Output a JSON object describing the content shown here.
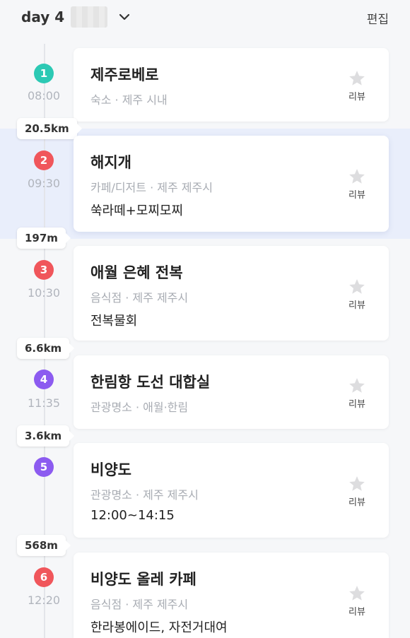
{
  "header": {
    "day_label": "day 4",
    "edit_label": "편집"
  },
  "colors": {
    "teal": "#2cc9b4",
    "red": "#f0565b",
    "purple": "#8c5bf0",
    "highlight": "#e9eefb"
  },
  "review_label": "리뷰",
  "stops": [
    {
      "num": "1",
      "time": "08:00",
      "title": "제주로베로",
      "sub": "숙소 · 제주 시내",
      "note": ""
    },
    {
      "num": "2",
      "time": "09:30",
      "title": "해지개",
      "sub": "카페/디저트 · 제주 제주시",
      "note": "쑥라떼+모찌모찌"
    },
    {
      "num": "3",
      "time": "10:30",
      "title": "애월 은혜 전복",
      "sub": "음식점 · 제주 제주시",
      "note": "전복물회"
    },
    {
      "num": "4",
      "time": "11:35",
      "title": "한림항 도선 대합실",
      "sub": "관광명소 · 애월·한림",
      "note": ""
    },
    {
      "num": "5",
      "time": "",
      "title": "비양도",
      "sub": "관광명소 · 제주 제주시",
      "note": "12:00~14:15"
    },
    {
      "num": "6",
      "time": "12:20",
      "title": "비양도 올레 카페",
      "sub": "음식점 · 제주 제주시",
      "note": "한라봉에이드, 자전거대여"
    }
  ],
  "distances": [
    "20.5km",
    "197m",
    "6.6km",
    "3.6km",
    "568m"
  ]
}
